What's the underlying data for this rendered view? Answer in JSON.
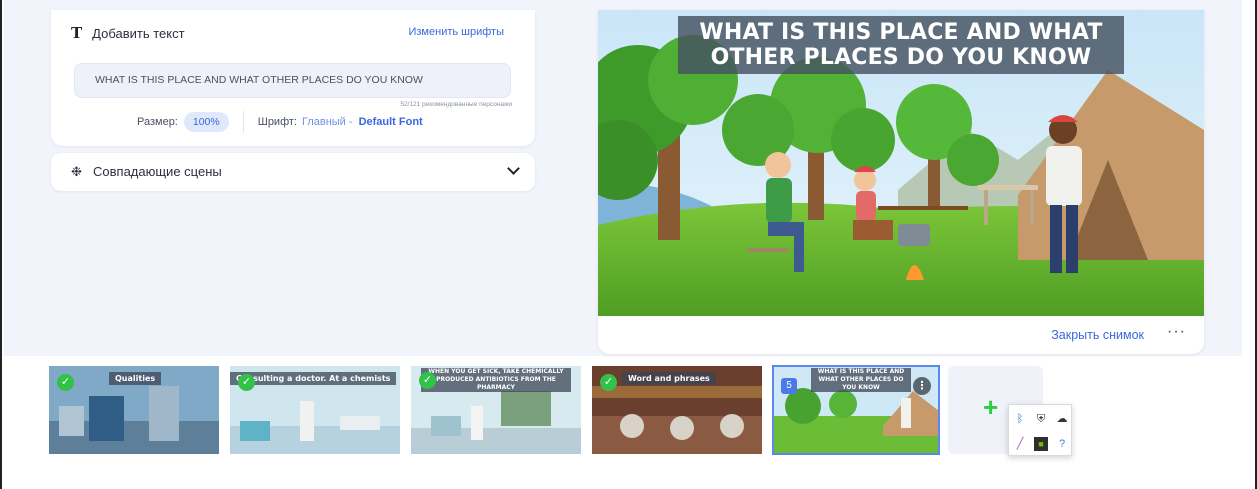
{
  "text_panel": {
    "title": "Добавить текст",
    "change_fonts": "Изменить шрифты",
    "text_value": "WHAT IS THIS PLACE AND WHAT OTHER PLACES DO YOU KNOW",
    "char_count": "52/121 рекомендованные персонажи",
    "size_label": "Размер:",
    "size_value": "100%",
    "font_label": "Шрифт:",
    "font_main": "Главный -",
    "font_default": "Default Font"
  },
  "scenes_panel": {
    "label": "Совпадающие сцены"
  },
  "preview": {
    "caption": "WHAT IS THIS PLACE AND WHAT OTHER PLACES DO YOU KNOW",
    "close_snapshot": "Закрыть снимок",
    "more": "···"
  },
  "timeline": {
    "thumbs": [
      {
        "label": "Qualities",
        "done": true
      },
      {
        "label": "Consulting a doctor. At a chemists",
        "done": true
      },
      {
        "label": "WHEN YOU GET SICK, TAKE CHEMICALLY PRODUCED ANTIBIOTICS FROM THE PHARMACY",
        "done": true
      },
      {
        "label": "Word and phrases",
        "done": true
      },
      {
        "label": "WHAT IS THIS PLACE AND WHAT OTHER PLACES DO YOU KNOW",
        "number": "5",
        "selected": true
      }
    ],
    "add": "+"
  },
  "colors": {
    "accent": "#3a67e0",
    "check": "#32c24a",
    "workspace": "#f2f4fb"
  }
}
